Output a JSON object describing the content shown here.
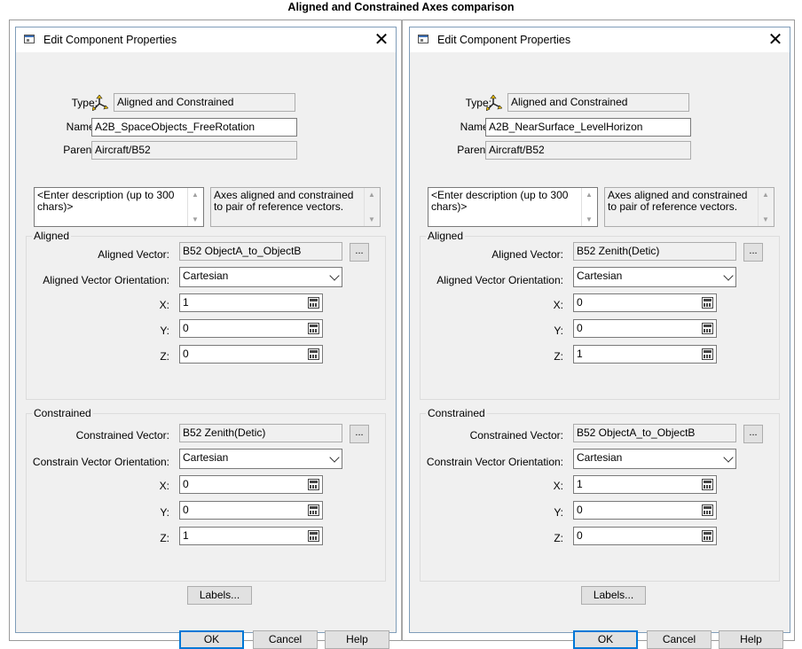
{
  "page_title": "Aligned and Constrained Axes comparison",
  "dialogs": [
    {
      "title": "Edit Component Properties",
      "type_label": "Type:",
      "type_value": "Aligned and Constrained",
      "name_label": "Name:",
      "name_value": "A2B_SpaceObjects_FreeRotation",
      "parent_label": "Parent:",
      "parent_value": "Aircraft/B52",
      "description": "<Enter description (up to 300 chars)>",
      "type_description": "Axes aligned and constrained to pair of reference vectors.",
      "aligned": {
        "group_label": "Aligned",
        "vector_label": "Aligned Vector:",
        "vector_value": "B52 ObjectA_to_ObjectB",
        "orientation_label": "Aligned Vector Orientation:",
        "orientation_value": "Cartesian",
        "x": "1",
        "y": "0",
        "z": "0"
      },
      "constrained": {
        "group_label": "Constrained",
        "vector_label": "Constrained Vector:",
        "vector_value": "B52 Zenith(Detic)",
        "orientation_label": "Constrain Vector Orientation:",
        "orientation_value": "Cartesian",
        "x": "0",
        "y": "0",
        "z": "1"
      },
      "x_label": "X:",
      "y_label": "Y:",
      "z_label": "Z:",
      "browse": "...",
      "labels_button": "Labels...",
      "ok": "OK",
      "cancel": "Cancel",
      "help": "Help",
      "close_glyph": "✕",
      "icon": "close-icon"
    },
    {
      "title": "Edit Component Properties",
      "type_label": "Type:",
      "type_value": "Aligned and Constrained",
      "name_label": "Name:",
      "name_value": "A2B_NearSurface_LevelHorizon",
      "parent_label": "Parent:",
      "parent_value": "Aircraft/B52",
      "description": "<Enter description (up to 300 chars)>",
      "type_description": "Axes aligned and constrained to pair of reference vectors.",
      "aligned": {
        "group_label": "Aligned",
        "vector_label": "Aligned Vector:",
        "vector_value": "B52 Zenith(Detic)",
        "orientation_label": "Aligned Vector Orientation:",
        "orientation_value": "Cartesian",
        "x": "0",
        "y": "0",
        "z": "1"
      },
      "constrained": {
        "group_label": "Constrained",
        "vector_label": "Constrained Vector:",
        "vector_value": "B52 ObjectA_to_ObjectB",
        "orientation_label": "Constrain Vector Orientation:",
        "orientation_value": "Cartesian",
        "x": "1",
        "y": "0",
        "z": "0"
      },
      "x_label": "X:",
      "y_label": "Y:",
      "z_label": "Z:",
      "browse": "...",
      "labels_button": "Labels...",
      "ok": "OK",
      "cancel": "Cancel",
      "help": "Help",
      "close_glyph": "✕",
      "icon": "close-icon"
    }
  ],
  "colors": {
    "dialog_bg": "#f0f0f0",
    "default_button_border": "#0078d7",
    "icon_yellow": "#e5b800"
  }
}
